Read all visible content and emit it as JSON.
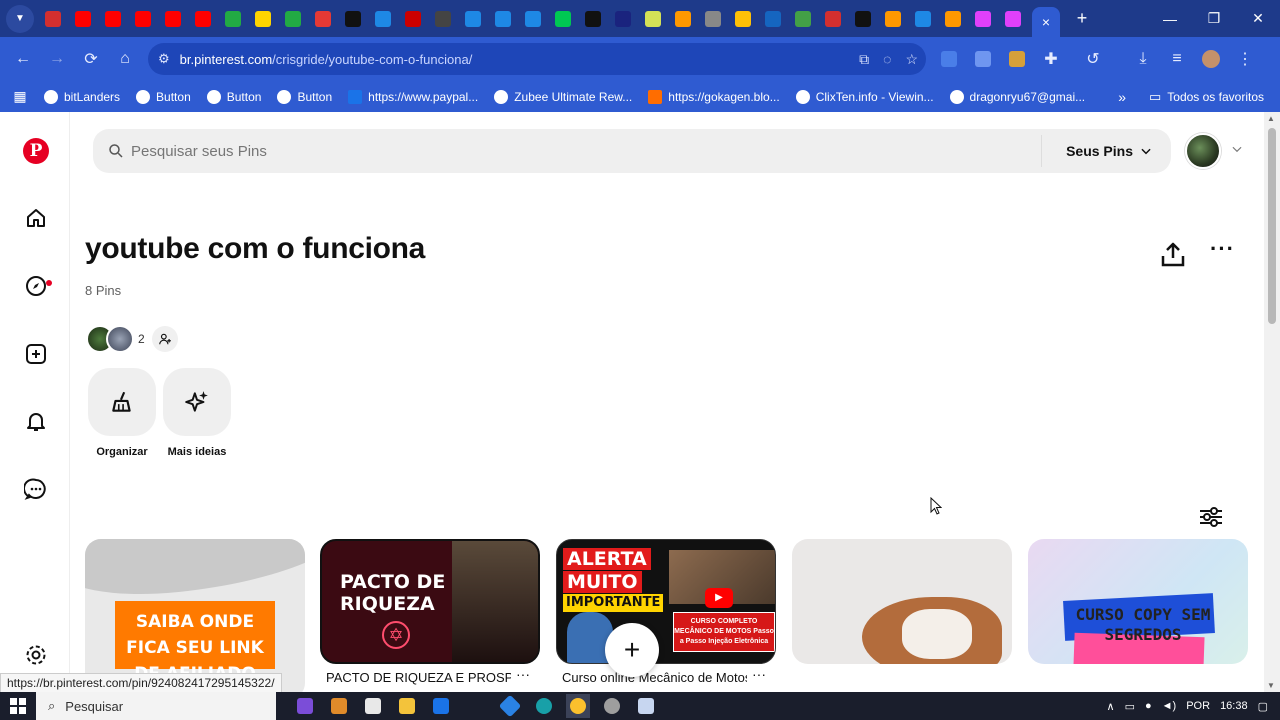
{
  "browser": {
    "url_host": "br.pinterest.com",
    "url_path": "/crisgride/youtube-com-o-funciona/",
    "tab_favicon_colors": [
      "#d32f2f",
      "#ff0000",
      "#ff0000",
      "#ff0000",
      "#ff0000",
      "#ff0000",
      "#22aa44",
      "#ffd400",
      "#22aa44",
      "#e53935",
      "#111111",
      "#1e88e5",
      "#cc0000",
      "#444444",
      "#1e88e5",
      "#1e88e5",
      "#1e88e5",
      "#00c853",
      "#111111",
      "#1a237e",
      "#d4e157",
      "#ff9800",
      "#888888",
      "#ffc107",
      "#1565c0",
      "#43a047",
      "#d32f2f",
      "#111111",
      "#ff9800",
      "#1e88e5",
      "#ff9800",
      "#e040fb",
      "#e040fb"
    ],
    "active_tab_close": "×",
    "new_tab": "+"
  },
  "bookmarks": {
    "items": [
      {
        "label": "bitLanders"
      },
      {
        "label": "Button"
      },
      {
        "label": "Button"
      },
      {
        "label": "Button"
      },
      {
        "label": "https://www.paypal..."
      },
      {
        "label": "Zubee Ultimate Rew..."
      },
      {
        "label": "https://gokagen.blo..."
      },
      {
        "label": "ClixTen.info - Viewin..."
      },
      {
        "label": "dragonryu67@gmai..."
      }
    ],
    "more": "»",
    "folder_label": "Todos os favoritos"
  },
  "header": {
    "search_placeholder": "Pesquisar seus Pins",
    "filter_label": "Seus Pins"
  },
  "board": {
    "title": "youtube com o funciona",
    "pin_count": "8 Pins",
    "collaborator_count": "2",
    "actions": [
      {
        "label": "Organizar"
      },
      {
        "label": "Mais ideias"
      }
    ]
  },
  "pins": [
    {
      "image_text": "SAIBA ONDE FICA SEU LINK DE AFILIADO",
      "title": ""
    },
    {
      "image_text": "PACTO DE RIQUEZA",
      "title": "PACTO DE RIQUEZA E PROSPERIDADE - Segredo Revelado"
    },
    {
      "image_text_1": "ALERTA",
      "image_text_2": "MUITO",
      "image_text_3": "IMPORTANTE",
      "banner": "CURSO COMPLETO MECÂNICO DE MOTOS Passo a Passo Injeção Eletrônica",
      "title": "Curso online Mecânico de Motos Carlos Gomes & Cia"
    },
    {
      "title": ""
    },
    {
      "image_text": "CURSO COPY SEM SEGREDOS",
      "title": ""
    }
  ],
  "status_url": "https://br.pinterest.com/pin/924082417295145322/",
  "taskbar": {
    "search_label": "Pesquisar",
    "language": "POR",
    "time": "16:38"
  }
}
